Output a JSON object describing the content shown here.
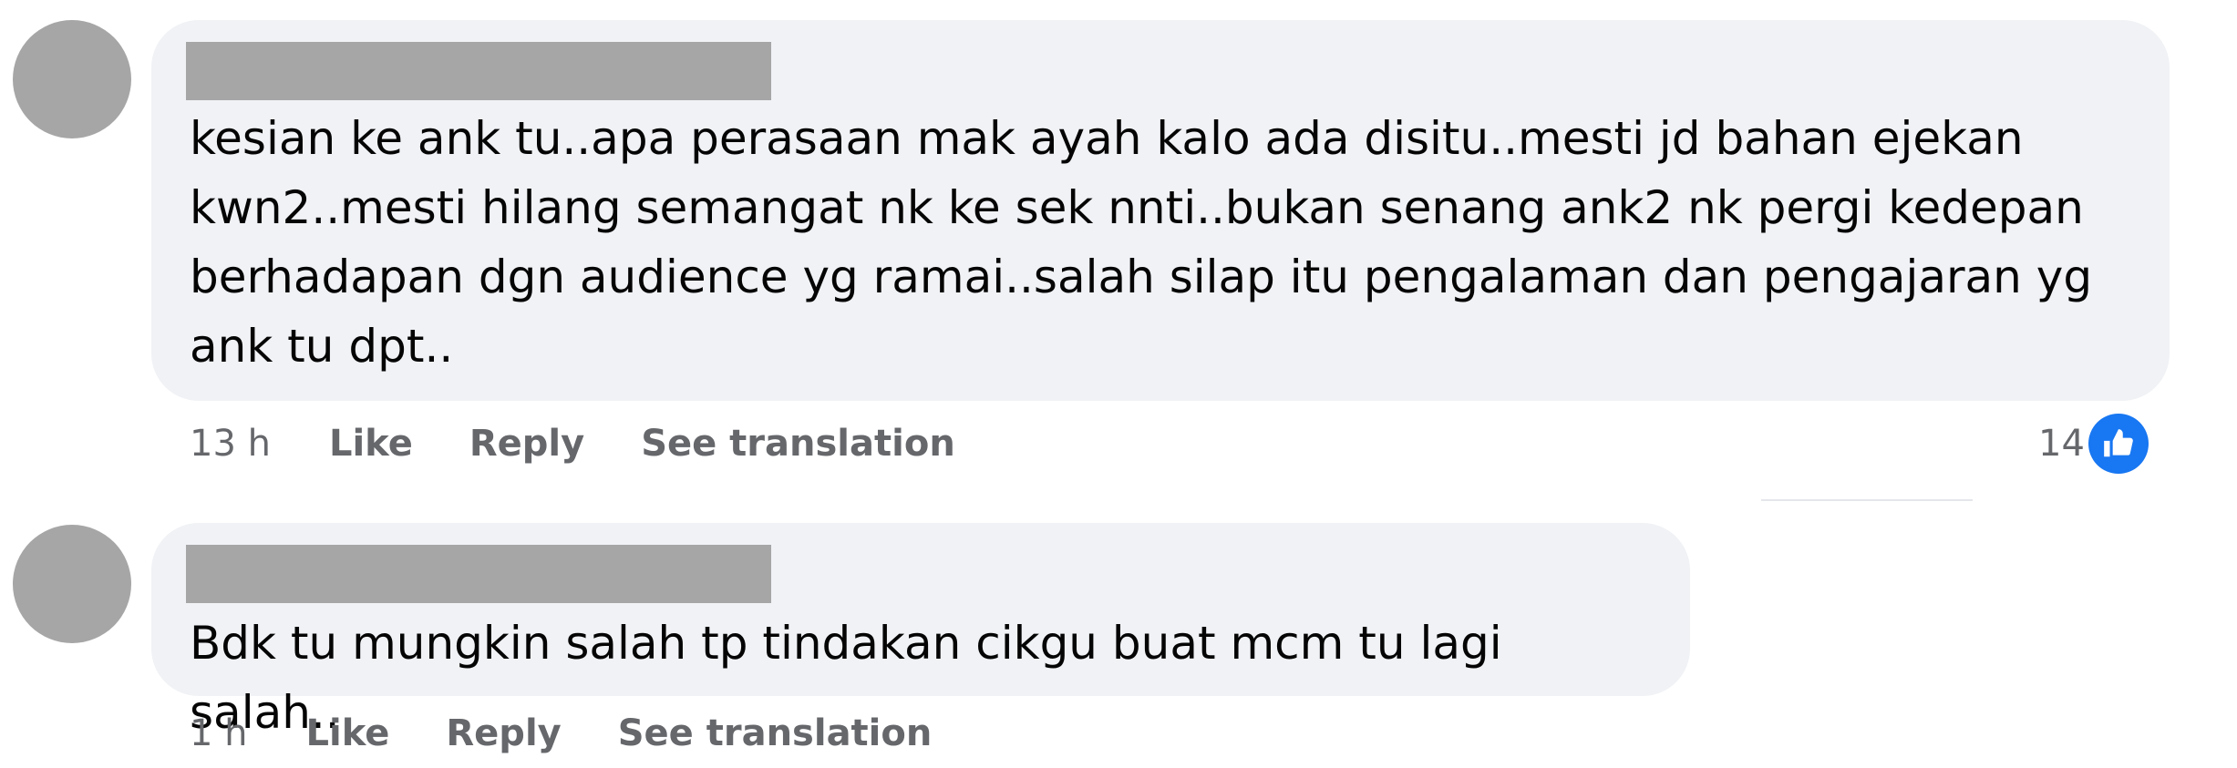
{
  "comments": [
    {
      "text": "kesian ke ank tu..apa perasaan mak ayah kalo ada disitu..mesti jd bahan ejekan\nkwn2..mesti hilang semangat nk ke sek nnti..bukan senang ank2 nk pergi kedepan\nberhadapan dgn audience yg ramai..salah silap itu pengalaman dan pengajaran yg\nank tu dpt..",
      "time": "13 h",
      "like_label": "Like",
      "reply_label": "Reply",
      "translate_label": "See translation",
      "reaction_count": "14",
      "reaction_icon": "like-reaction-icon"
    },
    {
      "text": "Bdk tu mungkin salah tp tindakan cikgu buat mcm tu lagi salah..",
      "time": "1 h",
      "like_label": "Like",
      "reply_label": "Reply",
      "translate_label": "See translation"
    }
  ],
  "colors": {
    "bubble": "#f0f2f5",
    "redaction": "#a6a6a6",
    "meta_text": "#65676b",
    "like_blue": "#1877f2"
  }
}
